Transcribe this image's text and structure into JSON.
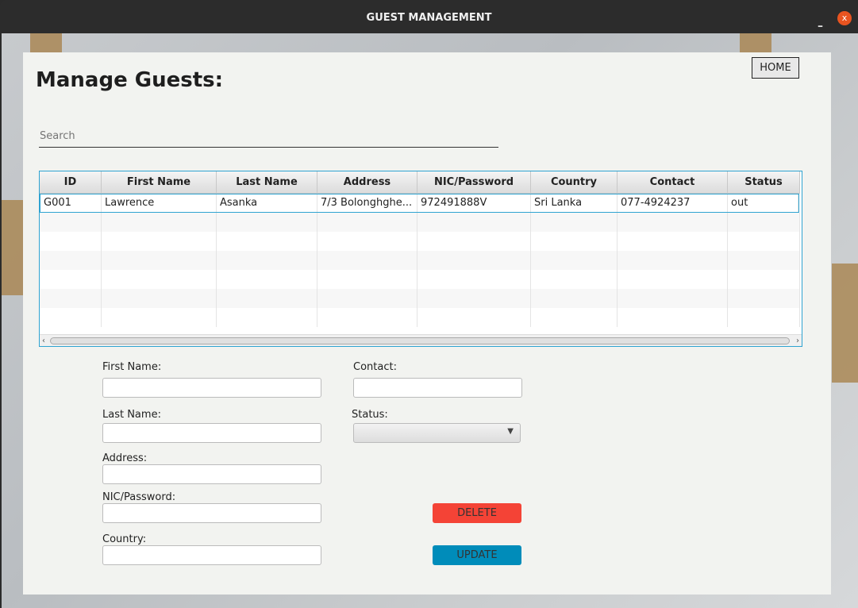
{
  "window": {
    "title": "GUEST MANAGEMENT",
    "minimize": "–",
    "close": "x"
  },
  "page": {
    "title": "Manage Guests:",
    "home": "HOME",
    "search_placeholder": "Search"
  },
  "table": {
    "columns": [
      "ID",
      "First Name",
      "Last Name",
      "Address",
      "NIC/Password",
      "Country",
      "Contact",
      "Status"
    ],
    "rows": [
      [
        "G001",
        "Lawrence",
        "Asanka",
        "7/3 Bolonghghe...",
        "972491888V",
        "Sri Lanka",
        "077-4924237",
        "out"
      ]
    ]
  },
  "form": {
    "first_name": "First Name:",
    "last_name": "Last Name:",
    "address": "Address:",
    "nic": "NIC/Password:",
    "country": "Country:",
    "contact": "Contact:",
    "status": "Status:",
    "delete": "DELETE",
    "update": "UPDATE"
  },
  "colors": {
    "delete": "#f44336",
    "update": "#008cba",
    "accent": "#2ea3d1"
  }
}
